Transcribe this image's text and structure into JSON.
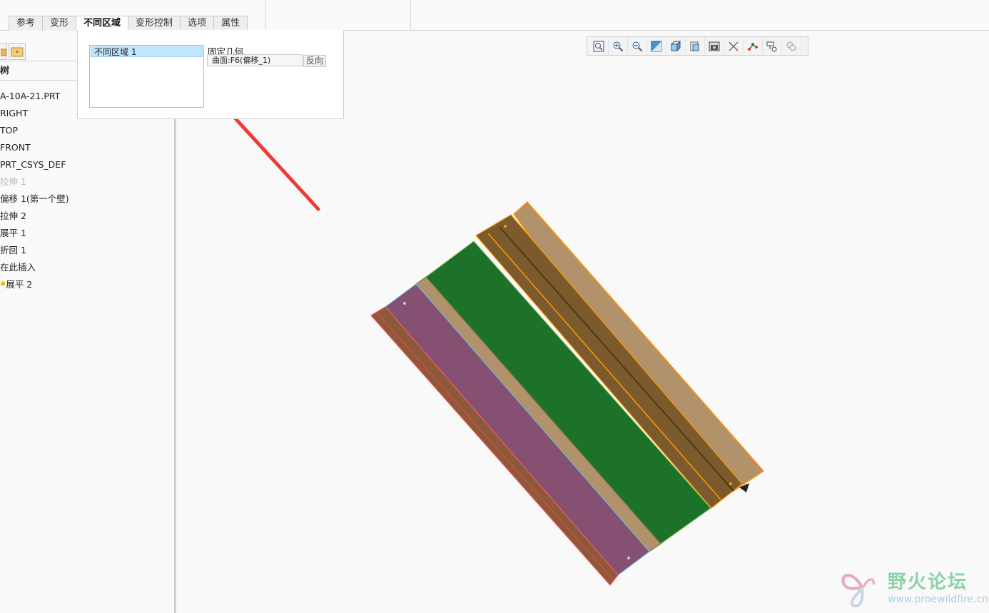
{
  "tabs": [
    {
      "label": "参考",
      "active": false
    },
    {
      "label": "变形",
      "active": false
    },
    {
      "label": "不同区域",
      "active": true
    },
    {
      "label": "变形控制",
      "active": false
    },
    {
      "label": "选项",
      "active": false
    },
    {
      "label": "属性",
      "active": false
    }
  ],
  "dashboard": {
    "region_item": "不同区域 1",
    "fixed_geometry_label": "固定几何",
    "surface_value": "曲面:F6(偏移_1)",
    "flip_label": "反向"
  },
  "model_tree": {
    "header": "树",
    "items": [
      {
        "label": "A-10A-21.PRT",
        "dim": false,
        "new": false
      },
      {
        "label": "RIGHT",
        "dim": false,
        "new": false
      },
      {
        "label": "TOP",
        "dim": false,
        "new": false
      },
      {
        "label": "FRONT",
        "dim": false,
        "new": false
      },
      {
        "label": "PRT_CSYS_DEF",
        "dim": false,
        "new": false
      },
      {
        "label": "拉伸 1",
        "dim": true,
        "new": false
      },
      {
        "label": "偏移 1(第一个壁)",
        "dim": false,
        "new": false
      },
      {
        "label": "拉伸 2",
        "dim": false,
        "new": false
      },
      {
        "label": "展平 1",
        "dim": false,
        "new": false
      },
      {
        "label": "折回 1",
        "dim": false,
        "new": false
      },
      {
        "label": "在此插入",
        "dim": false,
        "new": false
      },
      {
        "label": "展平 2",
        "dim": false,
        "new": true
      }
    ]
  },
  "view_toolbar": [
    "refit-icon",
    "zoom-in-icon",
    "zoom-out-icon",
    "repaint-icon",
    "display-style-icon",
    "saved-views-icon",
    "view-manager-icon",
    "datum-display-icon",
    "spin-center-icon",
    "annotation-display-icon",
    "appearance-icon"
  ],
  "model_colors": {
    "purple": "#855071",
    "green": "#1d7229",
    "brown": "#7b5a2d",
    "tan": "#b2926a",
    "accent_orange": "#ff9900",
    "arrow_red": "#ef3b36"
  },
  "watermark": {
    "title": "野火论坛",
    "url": "www.proewildfire.cn"
  }
}
